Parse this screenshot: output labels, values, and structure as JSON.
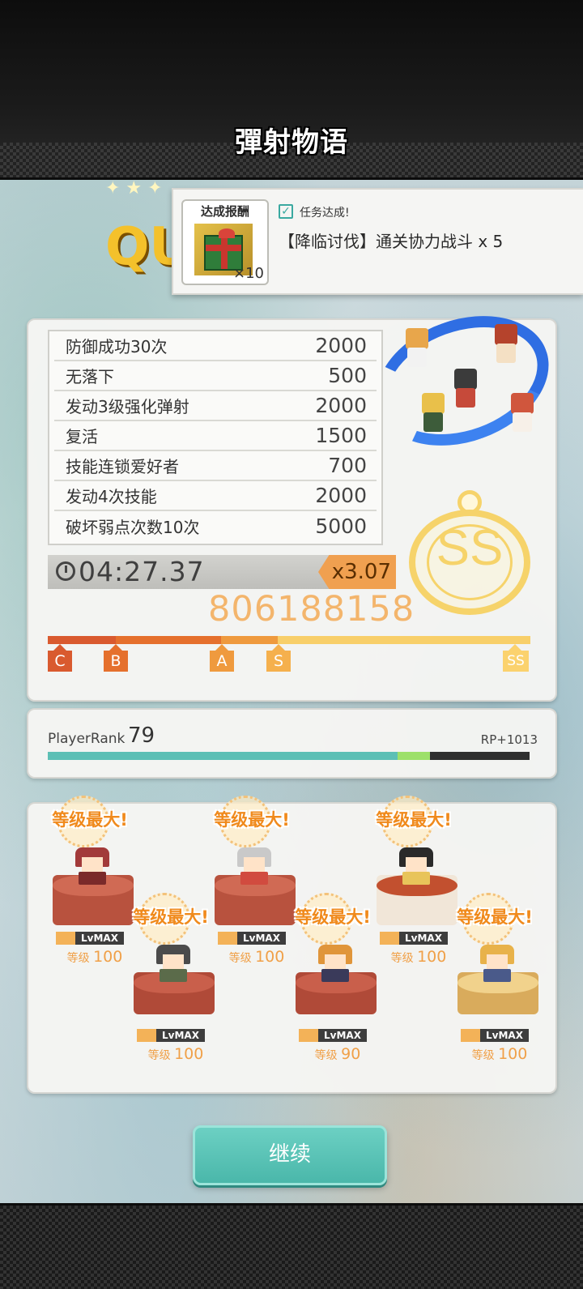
{
  "header": {
    "logo_text": "彈射物语"
  },
  "banner": {
    "quest_word": "QU"
  },
  "reward": {
    "title": "达成报酬",
    "quantity": "×10",
    "status": "任务达成!",
    "description": "【降临讨伐】通关协力战斗 x 5"
  },
  "bonuses": [
    {
      "name": "防御成功30次",
      "value": "2000"
    },
    {
      "name": "无落下",
      "value": "500"
    },
    {
      "name": "发动3级强化弹射",
      "value": "2000"
    },
    {
      "name": "复活",
      "value": "1500"
    },
    {
      "name": "技能连锁爱好者",
      "value": "700"
    },
    {
      "name": "发动4次技能",
      "value": "2000"
    },
    {
      "name": "破坏弱点次数10次",
      "value": "5000"
    }
  ],
  "result": {
    "time": "04:27.37",
    "multiplier": "x3.07",
    "total_score": "806188158",
    "rank": "SS"
  },
  "rank_scale": {
    "marks": [
      "C",
      "B",
      "A",
      "S",
      "SS"
    ],
    "achieved": "SS"
  },
  "player_rank": {
    "label": "PlayerRank",
    "value": "79",
    "rp_gain": "RP+1013",
    "progress_before": 0.726,
    "progress_after": 0.794
  },
  "units": [
    {
      "banner": "等级最大!",
      "tag": "LvMAX",
      "level_label": "等级",
      "level": "100"
    },
    {
      "banner": "等级最大!",
      "tag": "LvMAX",
      "level_label": "等级",
      "level": "100"
    },
    {
      "banner": "等级最大!",
      "tag": "LvMAX",
      "level_label": "等级",
      "level": "100"
    },
    {
      "banner": "等级最大!",
      "tag": "LvMAX",
      "level_label": "等级",
      "level": "100"
    },
    {
      "banner": "等级最大!",
      "tag": "LvMAX",
      "level_label": "等级",
      "level": "90"
    },
    {
      "banner": "等级最大!",
      "tag": "LvMAX",
      "level_label": "等级",
      "level": "100"
    }
  ],
  "actions": {
    "continue_label": "继续"
  },
  "colors": {
    "accent_teal": "#4ab7aa",
    "score_orange": "#f3b56c",
    "rank_gold": "#f6d36a",
    "level_orange": "#f08a1c"
  }
}
